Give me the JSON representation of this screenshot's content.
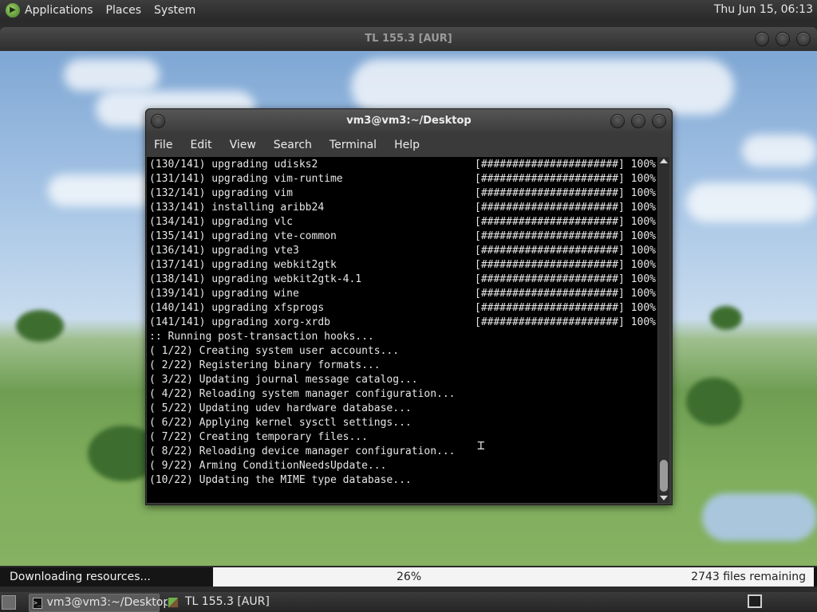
{
  "top_panel": {
    "menus": [
      "Applications",
      "Places",
      "System"
    ],
    "clock": "Thu Jun 15, 06:13"
  },
  "outer_window": {
    "title": "TL 155.3 [AUR]"
  },
  "terminal": {
    "title": "vm3@vm3:~/Desktop",
    "menus": [
      "File",
      "Edit",
      "View",
      "Search",
      "Terminal",
      "Help"
    ],
    "lines": [
      "(130/141) upgrading udisks2",
      "(131/141) upgrading vim-runtime",
      "(132/141) upgrading vim",
      "(133/141) installing aribb24",
      "(134/141) upgrading vlc",
      "(135/141) upgrading vte-common",
      "(136/141) upgrading vte3",
      "(137/141) upgrading webkit2gtk",
      "(138/141) upgrading webkit2gtk-4.1",
      "(139/141) upgrading wine",
      "(140/141) upgrading xfsprogs",
      "(141/141) upgrading xorg-xrdb",
      ":: Running post-transaction hooks...",
      "( 1/22) Creating system user accounts...",
      "( 2/22) Registering binary formats...",
      "( 3/22) Updating journal message catalog...",
      "( 4/22) Reloading system manager configuration...",
      "( 5/22) Updating udev hardware database...",
      "( 6/22) Applying kernel sysctl settings...",
      "( 7/22) Creating temporary files...",
      "( 8/22) Reloading device manager configuration...",
      "( 9/22) Arming ConditionNeedsUpdate...",
      "(10/22) Updating the MIME type database..."
    ],
    "progress_text": "[######################] 100%"
  },
  "download": {
    "status": "Downloading resources...",
    "percent": "26%",
    "remaining": "2743 files remaining",
    "progress_value": 26
  },
  "taskbar": {
    "items": [
      "vm3@vm3:~/Desktop",
      "TL 155.3 [AUR]"
    ]
  }
}
